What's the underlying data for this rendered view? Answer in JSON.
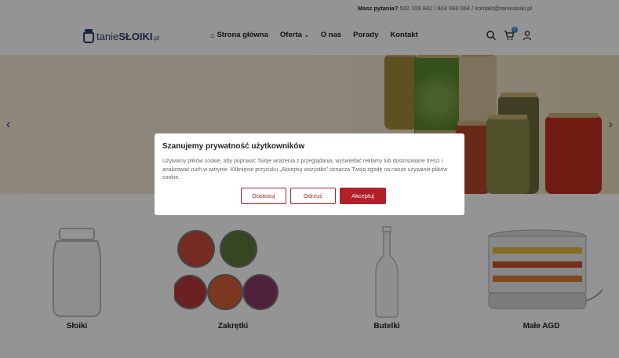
{
  "topbar": {
    "question_label": "Masz pytania?",
    "phones": "502 109 842 / 604 993 064 /",
    "email": "kontakt@taniesloiki.pl"
  },
  "logo": {
    "part1": "tanie",
    "part2": "SŁOIKI",
    "part3": ".pl"
  },
  "nav": {
    "home": "Strona główna",
    "offer": "Oferta",
    "about": "O nas",
    "tips": "Porady",
    "contact": "Kontakt"
  },
  "header_icons": {
    "search": "search-icon",
    "cart": "cart-icon",
    "user": "user-icon",
    "cart_count": "0"
  },
  "hero": {
    "prev": "‹",
    "next": "›"
  },
  "categories": [
    {
      "label": "Słoiki"
    },
    {
      "label": "Zakrętki"
    },
    {
      "label": "Butelki"
    },
    {
      "label": "Małe AGD"
    }
  ],
  "cookie": {
    "title": "Szanujemy prywatność użytkowników",
    "text": "Używamy plików cookie, aby poprawić Twoje wrażenia z przeglądania, wyświetlać reklamy lub dostosowane treści i analizować ruch w witrynie. Kliknięcie przycisku „Akceptuj wszystko” oznacza Twoją zgodę na nasze używanie plików cookie.",
    "customize": "Dostosuj",
    "reject": "Odrzuć",
    "accept": "Akceptuj"
  },
  "colors": {
    "accent": "#b3202a",
    "brand": "#2c3e6b",
    "badge": "#2c8fd6"
  }
}
